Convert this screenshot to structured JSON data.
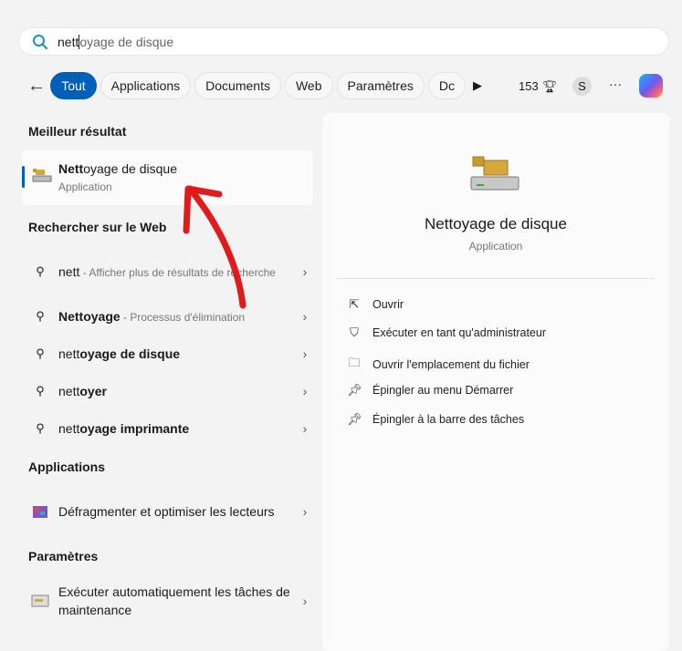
{
  "search": {
    "typed": "nett",
    "completion": "oyage de disque",
    "icon": "search-icon"
  },
  "filters": {
    "back": "←",
    "chips": [
      "Tout",
      "Applications",
      "Documents",
      "Web",
      "Paramètres",
      "Dc"
    ],
    "active": "Tout",
    "points": "153",
    "avatar": "S",
    "more": "···"
  },
  "best": {
    "header": "Meilleur résultat",
    "title_bold": "Nett",
    "title_rest": "oyage de disque",
    "type": "Application"
  },
  "web": {
    "header": "Rechercher sur le Web",
    "items": [
      {
        "bold": "nett",
        "rest": "",
        "hint": " - Afficher plus de résultats de recherche"
      },
      {
        "bold": "Nettoyage",
        "rest": "",
        "hint": " - Processus d'élimination"
      },
      {
        "bold": "",
        "pre": "nett",
        "rest": "oyage de disque",
        "hint": ""
      },
      {
        "bold": "",
        "pre": "nett",
        "rest": "oyer",
        "hint": ""
      },
      {
        "bold": "",
        "pre": "nett",
        "rest": "oyage imprimante",
        "hint": ""
      }
    ]
  },
  "apps": {
    "header": "Applications",
    "items": [
      {
        "label": "Défragmenter et optimiser les lecteurs"
      }
    ]
  },
  "settings": {
    "header": "Paramètres",
    "items": [
      {
        "label": "Exécuter automatiquement les tâches de maintenance"
      }
    ]
  },
  "preview": {
    "title": "Nettoyage de disque",
    "type": "Application",
    "actions": [
      "Ouvrir",
      "Exécuter en tant qu'administrateur",
      "Ouvrir l'emplacement du fichier",
      "Épingler au menu Démarrer",
      "Épingler à la barre des tâches"
    ]
  },
  "colors": {
    "accent": "#005fb8",
    "annotation": "#e01b1b"
  }
}
